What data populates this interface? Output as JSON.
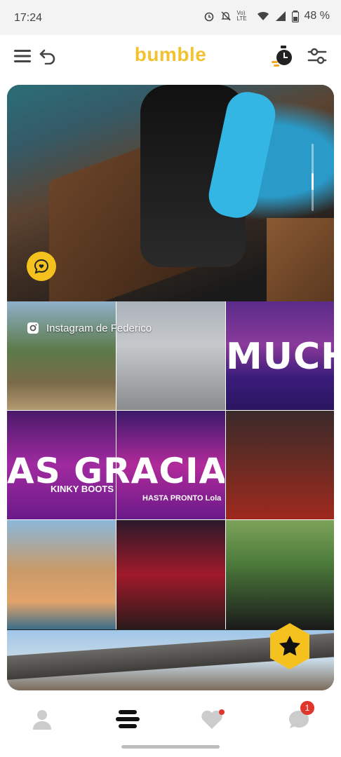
{
  "status_bar": {
    "time": "17:24",
    "network_label": "Vo) LTE",
    "battery": "48 %"
  },
  "header": {
    "logo": "bumble",
    "icons": [
      "menu-icon",
      "undo-icon",
      "timer-icon",
      "filter-icon"
    ]
  },
  "profile": {
    "instagram_label": "Instagram de Federico",
    "photo_texts": {
      "much": "MUCH",
      "as_gracias": "AS GRACIAS",
      "kinky_boots": "KINKY BOOTS",
      "hasta_pronto": "HASTA PRONTO Lola"
    }
  },
  "bottom_nav": {
    "items": [
      "profile",
      "discover",
      "liked-you",
      "chats"
    ],
    "chat_badge": "1"
  },
  "colors": {
    "brand": "#f5c11f",
    "badge": "#e0352b"
  }
}
